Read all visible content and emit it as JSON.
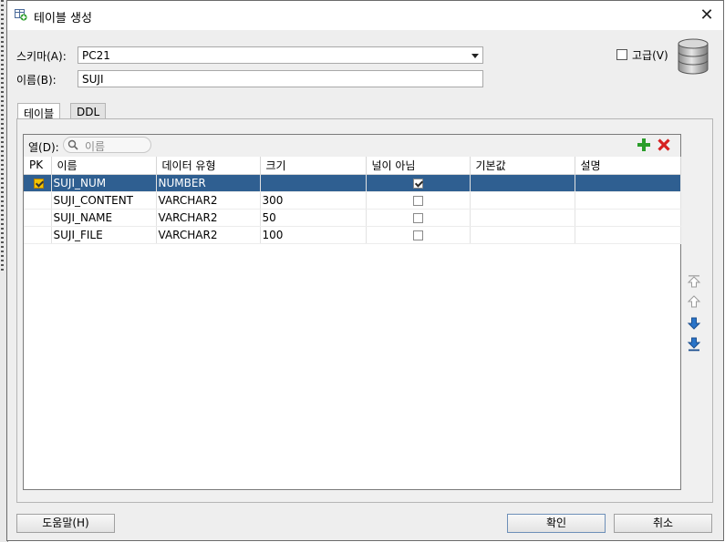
{
  "dialog": {
    "title": "테이블 생성",
    "close_glyph": "✕"
  },
  "form": {
    "schema_label": "스키마(A):",
    "schema_value": "PC21",
    "name_label": "이름(B):",
    "name_value": "SUJI",
    "advanced_label": "고급(V)",
    "advanced_checked": false
  },
  "tabs": [
    {
      "label": "테이블",
      "active": true
    },
    {
      "label": "DDL",
      "active": false
    }
  ],
  "columns_panel": {
    "filter_label": "열(D):",
    "search_placeholder": "이름",
    "headers": [
      "PK",
      "이름",
      "데이터 유형",
      "크기",
      "널이 아님",
      "기본값",
      "설명"
    ],
    "rows": [
      {
        "pk": true,
        "name": "SUJI_NUM",
        "type": "NUMBER",
        "size": "",
        "not_null": true,
        "default": "",
        "comment": "",
        "selected": true
      },
      {
        "pk": false,
        "name": "SUJI_CONTENT",
        "type": "VARCHAR2",
        "size": "300",
        "not_null": false,
        "default": "",
        "comment": "",
        "selected": false
      },
      {
        "pk": false,
        "name": "SUJI_NAME",
        "type": "VARCHAR2",
        "size": "50",
        "not_null": false,
        "default": "",
        "comment": "",
        "selected": false
      },
      {
        "pk": false,
        "name": "SUJI_FILE",
        "type": "VARCHAR2",
        "size": "100",
        "not_null": false,
        "default": "",
        "comment": "",
        "selected": false
      }
    ]
  },
  "icons": {
    "add": "plus-icon",
    "remove": "delete-icon",
    "move_top": "move-top-icon",
    "move_up": "move-up-icon",
    "move_down": "move-down-icon",
    "move_bottom": "move-bottom-icon",
    "database": "database-icon"
  },
  "buttons": {
    "help": "도움말(H)",
    "ok": "확인",
    "cancel": "취소"
  },
  "colors": {
    "selection": "#2f5f91",
    "pk_check": "#f3c400",
    "add_green": "#2a9d2a",
    "delete_red": "#d62020",
    "arrow_blue": "#2a74c8"
  }
}
